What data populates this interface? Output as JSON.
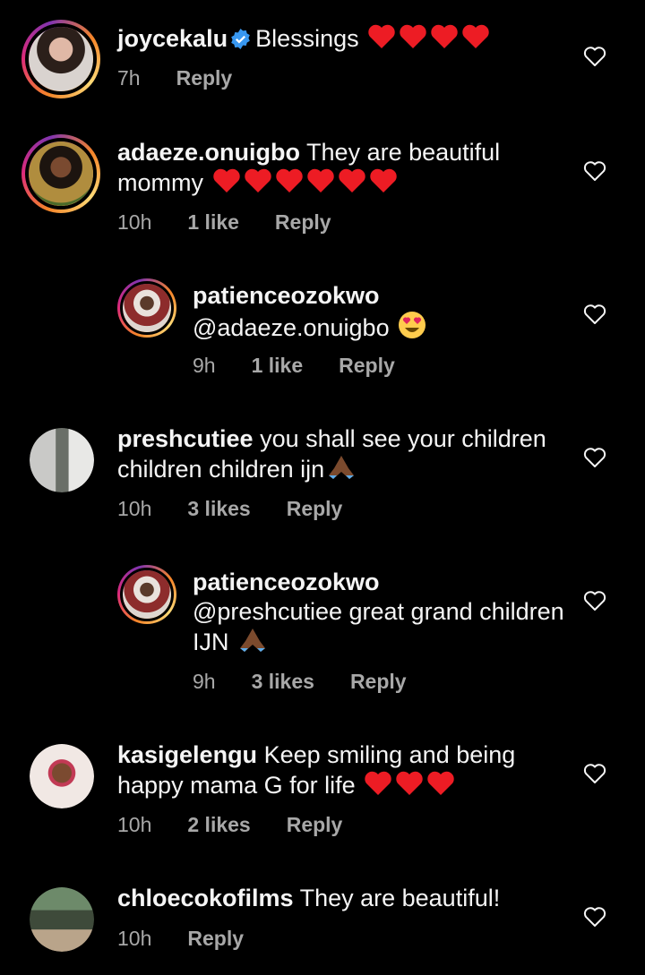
{
  "comments": [
    {
      "username": "joycekalu",
      "verified": true,
      "text": "Blessings",
      "emojis": "red-heart x4",
      "time": "7h",
      "likes": "",
      "reply": "Reply"
    },
    {
      "username": "adaeze.onuigbo",
      "text": "They are beautiful mommy",
      "emojis": "red-heart x6",
      "time": "10h",
      "likes": "1 like",
      "reply": "Reply"
    },
    {
      "username": "patienceozokwo",
      "mention": "@adaeze.onuigbo",
      "text": "",
      "emojis": "heart-eyes",
      "time": "9h",
      "likes": "1 like",
      "reply": "Reply"
    },
    {
      "username": "preshcutiee",
      "text": "you shall see your children children children ijn",
      "emojis": "folded-hands",
      "time": "10h",
      "likes": "3 likes",
      "reply": "Reply"
    },
    {
      "username": "patienceozokwo",
      "mention": "@preshcutiee",
      "text": "great grand children IJN",
      "emojis": "folded-hands",
      "time": "9h",
      "likes": "3 likes",
      "reply": "Reply"
    },
    {
      "username": "kasigelengu",
      "text": "Keep smiling and being happy mama G for life",
      "emojis": "red-heart x3",
      "time": "10h",
      "likes": "2 likes",
      "reply": "Reply"
    },
    {
      "username": "chloecokofilms",
      "text": "They are beautiful!",
      "emojis": "",
      "time": "10h",
      "likes": "",
      "reply": "Reply"
    }
  ],
  "colors": {
    "background": "#000000",
    "text": "#f5f5f5",
    "meta": "#a8a8a8",
    "verified": "#3897f0",
    "heart": "#ed1c24"
  },
  "icons": {
    "like": "heart-outline-icon",
    "verified": "verified-badge-icon"
  }
}
